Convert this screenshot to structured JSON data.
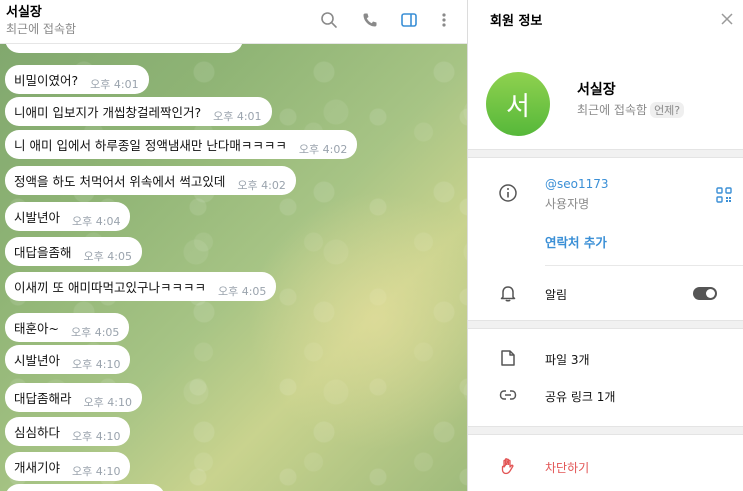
{
  "chat": {
    "title": "서실장",
    "status": "최근에 접속함"
  },
  "messages": [
    {
      "text": "비밀이였어?",
      "time": "오후 4:01"
    },
    {
      "text": "니애미 입보지가 개씹창걸레짝인거?",
      "time": "오후 4:01"
    },
    {
      "text": "니 애미 입에서 하루종일 정액냄새만 난다매ㅋㅋㅋㅋ",
      "time": "오후 4:02"
    },
    {
      "text": "정액을 하도 처먹어서 위속에서 썩고있데",
      "time": "오후 4:02"
    },
    {
      "text": "시발년아",
      "time": "오후 4:04"
    },
    {
      "text": "대답을좀해",
      "time": "오후 4:05"
    },
    {
      "text": "이새끼 또 애미따먹고있구나ㅋㅋㅋㅋ",
      "time": "오후 4:05"
    },
    {
      "text": "태훈아~",
      "time": "오후 4:05"
    },
    {
      "text": "시발년아",
      "time": "오후 4:10"
    },
    {
      "text": "대답좀해라",
      "time": "오후 4:10"
    },
    {
      "text": "심심하다",
      "time": "오후 4:10"
    },
    {
      "text": "개새기야",
      "time": "오후 4:10"
    }
  ],
  "info": {
    "header_title": "회원 정보",
    "avatar_letter": "서",
    "name": "서실장",
    "status": "최근에 접속함",
    "when_badge": "언제?",
    "username": "@seo1173",
    "username_label": "사용자명",
    "add_contact": "연락처 추가",
    "notifications_label": "알림",
    "notifications_on": false,
    "files_label": "파일 3개",
    "links_label": "공유 링크 1개",
    "block_label": "차단하기"
  },
  "colors": {
    "accent": "#3a8fd6",
    "danger": "#e25555",
    "avatar": "#6cc344"
  },
  "icons": [
    "search-icon",
    "phone-icon",
    "sidebar-toggle-icon",
    "more-vertical-icon",
    "close-icon",
    "info-icon",
    "qr-code-icon",
    "bell-icon",
    "file-icon",
    "link-icon",
    "hand-stop-icon"
  ]
}
